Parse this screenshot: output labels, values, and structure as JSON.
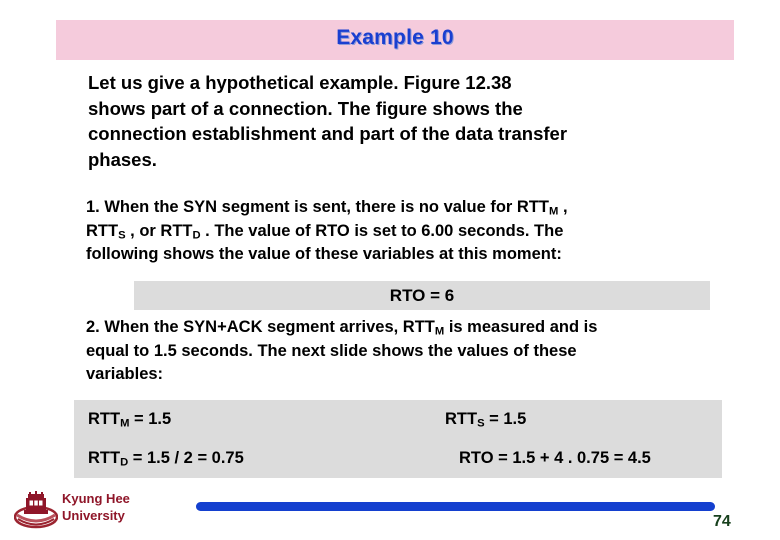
{
  "slide": {
    "title": "Example 10",
    "page_number": "74",
    "colors": {
      "title_banner_bg": "#f5cbdc",
      "title_text": "#1a3fd0",
      "gray_box_bg": "#dcdcdc",
      "footer_text": "#8f1629",
      "blue_bar": "#1440cf",
      "page_number": "#17401d"
    }
  },
  "paragraphs": {
    "intro": {
      "lines": [
        "Let us give a hypothetical example. Figure 12.38",
        "shows part of a connection. The figure shows the",
        "connection establishment and part of the data transfer",
        "phases."
      ]
    },
    "step1": {
      "line1_pre": "1. When the SYN segment is sent, there is no value for RTT",
      "line1_sub": "M",
      "line1_post": " ,",
      "line2_pre": "RTT",
      "line2_sub1": "S",
      "line2_mid": " , or RTT",
      "line2_sub2": "D",
      "line2_post": " . The value of RTO is set to 6.00 seconds. The",
      "line3": "following shows the value of these variables at this moment:"
    },
    "step2": {
      "line1_pre": "2. When the SYN+ACK segment arrives, RTT",
      "line1_sub": "M",
      "line1_post": " is measured and is",
      "line2": "equal to 1.5 seconds. The next slide shows the values of these",
      "line3": "variables:"
    }
  },
  "rto_box": {
    "label": "RTO = 6"
  },
  "values_box": {
    "rows": [
      {
        "left": {
          "name_pre": "RTT",
          "name_sub": "M",
          "value": " = 1.5"
        },
        "right": {
          "name_pre": "RTT",
          "name_sub": "S",
          "value": " = 1.5"
        }
      },
      {
        "left": {
          "name_pre": "RTT",
          "name_sub": "D",
          "value": " = 1.5 / 2 = 0.75"
        },
        "right": {
          "name_pre": "RTO",
          "name_sub": "",
          "value": " = 1.5 + 4 . 0.75 = 4.5"
        }
      }
    ]
  },
  "footer": {
    "logo_name_line1": "Kyung Hee",
    "logo_name_line2": "University"
  }
}
